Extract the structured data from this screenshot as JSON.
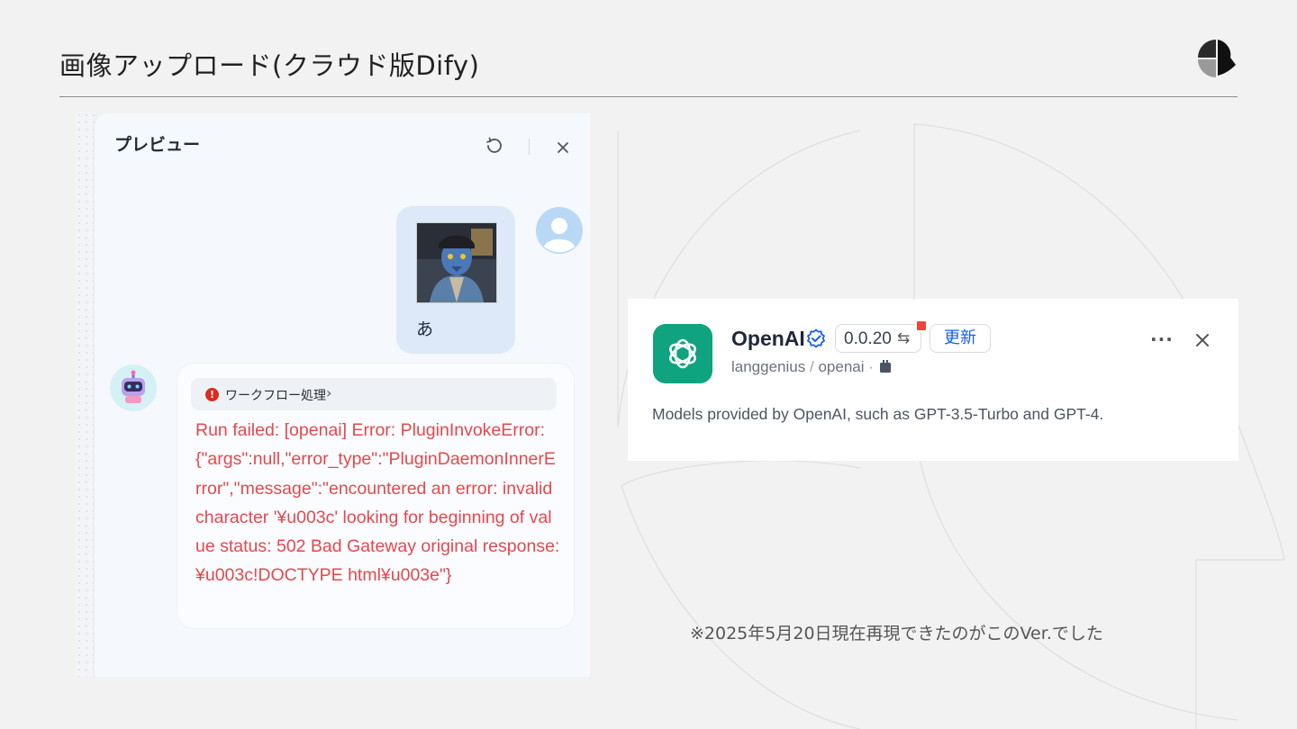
{
  "slide": {
    "title": "画像アップロード(クラウド版Dify)",
    "footnote": "※2025年5月20日現在再現できたのがこのVer.でした"
  },
  "preview": {
    "title": "プレビュー",
    "user_message": "あ",
    "workflow_label": "ワークフロー処理",
    "error_message": "Run failed: [openai] Error: PluginInvokeError: {\"args\":null,\"error_type\":\"PluginDaemonInnerError\",\"message\":\"encountered an error: invalid character '¥u003c' looking for beginning of value status: 502 Bad Gateway original response: ¥u003c!DOCTYPE html¥u003e\"}",
    "icons": {
      "refresh": "refresh-icon",
      "close": "close-icon",
      "error": "error-icon",
      "chevron": "chevron-right-icon"
    }
  },
  "plugin": {
    "name": "OpenAI",
    "version": "0.0.20",
    "update_label": "更新",
    "author": "langgenius",
    "separator": "/",
    "package": "openai",
    "description": "Models provided by OpenAI, such as GPT-3.5-Turbo and GPT-4.",
    "icons": {
      "verified": "verified-icon",
      "swap": "swap-icon",
      "more": "more-icon",
      "close": "close-icon"
    }
  }
}
